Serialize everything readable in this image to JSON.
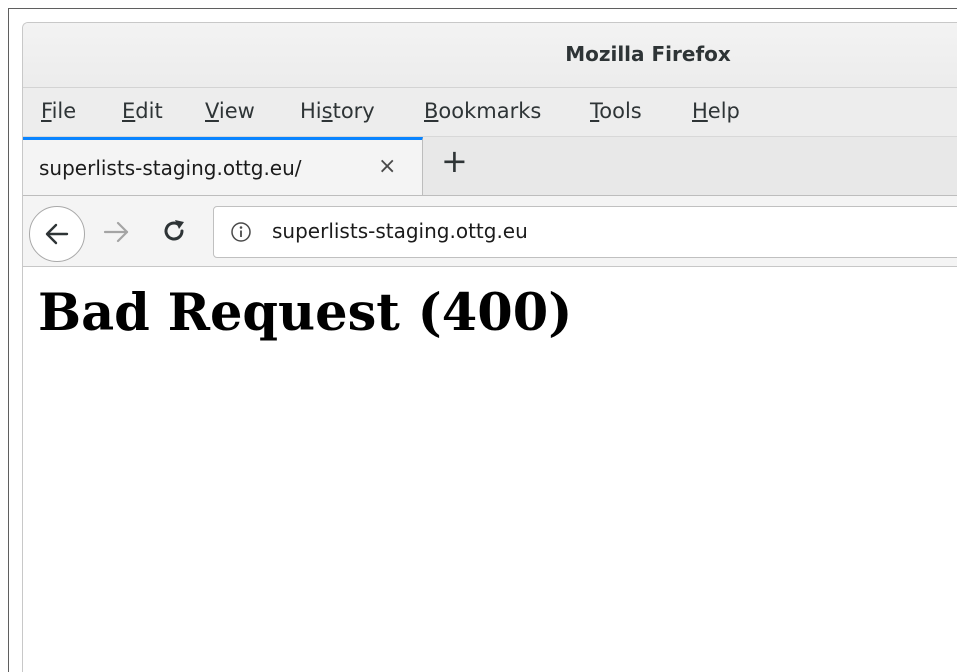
{
  "window": {
    "title": "Mozilla Firefox"
  },
  "menubar": {
    "items": [
      {
        "accel": "F",
        "rest": "ile"
      },
      {
        "accel": "E",
        "rest": "dit"
      },
      {
        "accel": "V",
        "rest": "iew"
      },
      {
        "pre": "Hi",
        "accel": "s",
        "rest": "tory"
      },
      {
        "accel": "B",
        "rest": "ookmarks"
      },
      {
        "accel": "T",
        "rest": "ools"
      },
      {
        "accel": "H",
        "rest": "elp"
      }
    ]
  },
  "tabs": {
    "active_title": "superlists-staging.ottg.eu/",
    "close_glyph": "×",
    "new_tab_glyph": "+"
  },
  "navigation": {
    "back_icon": "arrow-left-icon",
    "forward_icon": "arrow-right-icon",
    "reload_icon": "reload-icon",
    "site_info_icon": "info-icon",
    "url": "superlists-staging.ottg.eu"
  },
  "page": {
    "heading": "Bad Request (400)"
  },
  "colors": {
    "tab_accent": "#0a84ff",
    "heading": "#000000"
  }
}
